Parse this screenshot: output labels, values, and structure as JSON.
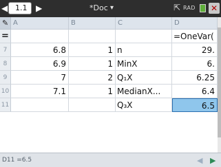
{
  "topbar": {
    "nav_left": "◀",
    "tab_label": "1.1",
    "nav_right": "▶",
    "doc_title": "*Doc",
    "doc_chevron": "▾",
    "mode": "RAD",
    "close": "✕",
    "battery_color": "#5fae3a"
  },
  "columns": [
    "A",
    "B",
    "C",
    "D"
  ],
  "equation_row": {
    "d": "=OneVar("
  },
  "rows": [
    {
      "num": "7",
      "a": "6.8",
      "b": "1",
      "c": "n",
      "d": "29."
    },
    {
      "num": "8",
      "a": "6.9",
      "b": "1",
      "c": "MinX",
      "d": "6."
    },
    {
      "num": "9",
      "a": "7",
      "b": "2",
      "c": "Q₁X",
      "d": "6.25"
    },
    {
      "num": "10",
      "a": "7.1",
      "b": "1",
      "c": "MedianX...",
      "d": "6.4"
    },
    {
      "num": "11",
      "a": "",
      "b": "",
      "c": "Q₃X",
      "d": "6.5"
    }
  ],
  "status": {
    "text": "D11 =6.5"
  },
  "colors": {
    "selected": "#8fc6ec",
    "header": "#dde4ec"
  }
}
